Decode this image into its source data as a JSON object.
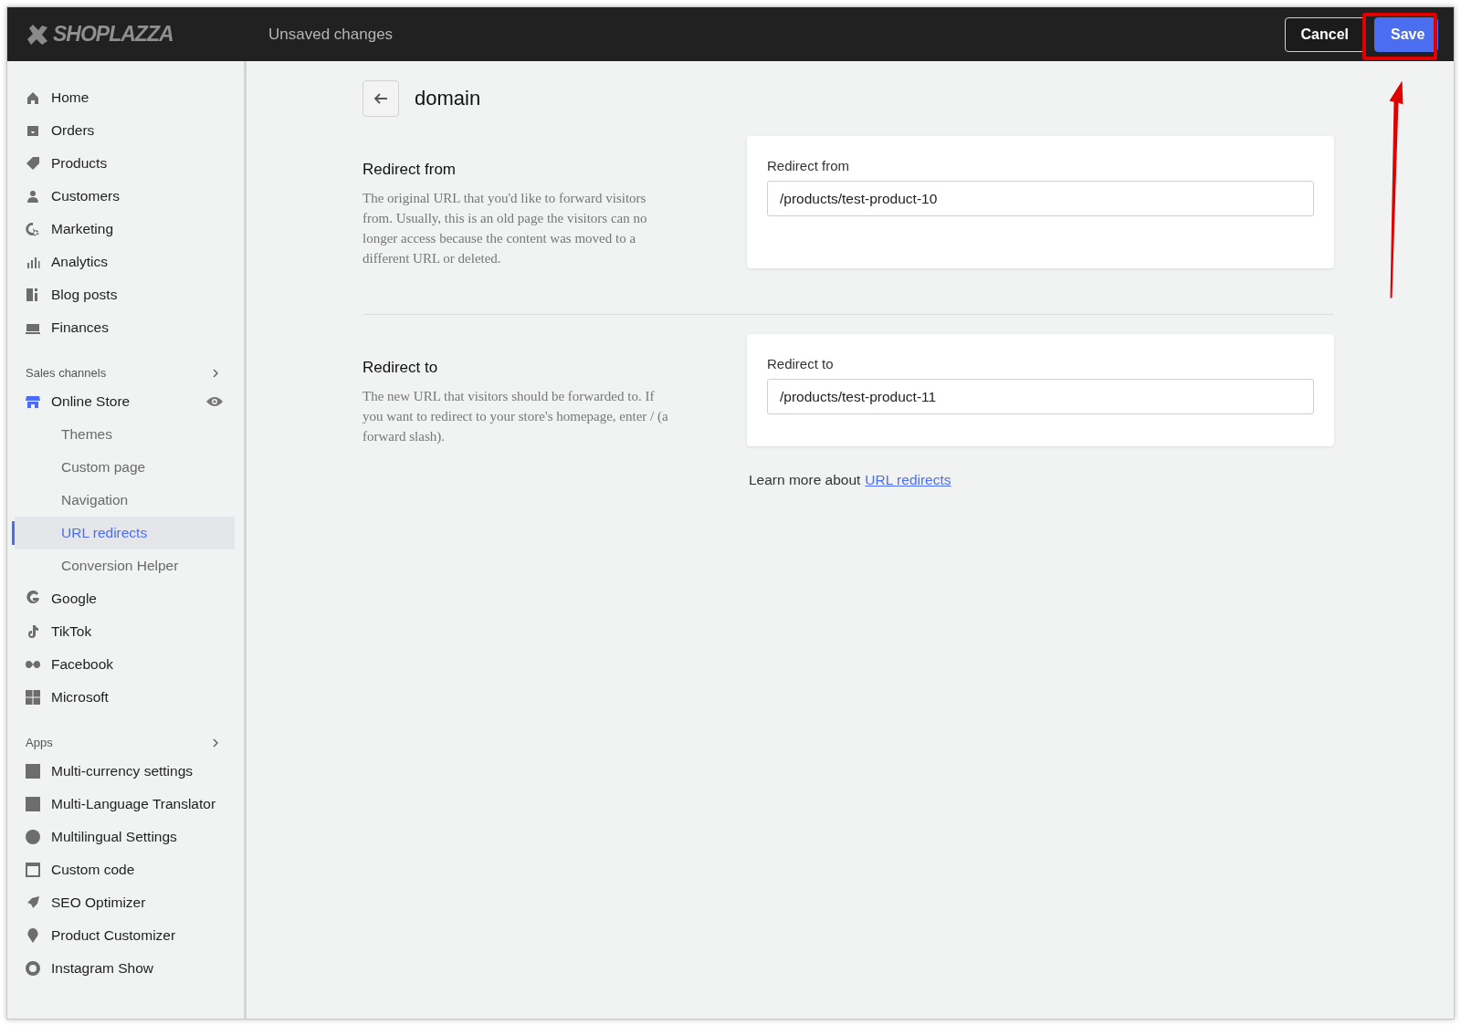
{
  "top_bar": {
    "logo": "SHOPLAZZA",
    "status": "Unsaved changes",
    "buttons": [
      {
        "label": "Cancel",
        "kind": "secondary"
      },
      {
        "label": "Save",
        "kind": "primary"
      }
    ]
  },
  "sidebar": {
    "groups": [
      {
        "items": [
          {
            "label": "Home",
            "selected": false
          },
          {
            "label": "Orders",
            "selected": false
          },
          {
            "label": "Products",
            "selected": false
          },
          {
            "label": "Customers",
            "selected": false
          },
          {
            "label": "Marketing",
            "selected": false
          },
          {
            "label": "Analytics",
            "selected": false
          },
          {
            "label": "Blog posts",
            "selected": false
          },
          {
            "label": "Finances",
            "selected": false
          }
        ]
      },
      {
        "heading": "Sales channels",
        "items": [
          {
            "label": "Online Store",
            "selected": false,
            "children": [
              {
                "label": "Themes",
                "selected": false
              },
              {
                "label": "Custom page",
                "selected": false
              },
              {
                "label": "Navigation",
                "selected": false
              },
              {
                "label": "URL redirects",
                "selected": true
              },
              {
                "label": "Conversion Helper",
                "selected": false
              }
            ]
          },
          {
            "label": "Google",
            "selected": false
          },
          {
            "label": "TikTok",
            "selected": false
          },
          {
            "label": "Facebook",
            "selected": false
          },
          {
            "label": "Microsoft",
            "selected": false
          }
        ]
      },
      {
        "heading": "Apps",
        "items": [
          {
            "label": "Multi-currency settings",
            "selected": false
          },
          {
            "label": "Multi-Language Translator",
            "selected": false
          },
          {
            "label": "Multilingual Settings",
            "selected": false
          },
          {
            "label": "Custom code",
            "selected": false
          },
          {
            "label": "SEO Optimizer",
            "selected": false
          },
          {
            "label": "Product Customizer",
            "selected": false
          },
          {
            "label": "Instagram Show",
            "selected": false
          }
        ]
      }
    ]
  },
  "page": {
    "title": "domain",
    "sections": [
      {
        "title": "Redirect from",
        "description": "The original URL that you'd like to forward visitors from. Usually, this is an old page the visitors can no longer access because the content was moved to a different URL or deleted.",
        "field_label": "Redirect from",
        "value": "/products/test-product-10"
      },
      {
        "title": "Redirect to",
        "description": "The new URL that visitors should be forwarded to. If you want to redirect to your store's homepage, enter / (a forward slash).",
        "field_label": "Redirect to",
        "value": "/products/test-product-11"
      }
    ],
    "footer_text": "Learn more about",
    "footer_link": "URL redirects"
  }
}
